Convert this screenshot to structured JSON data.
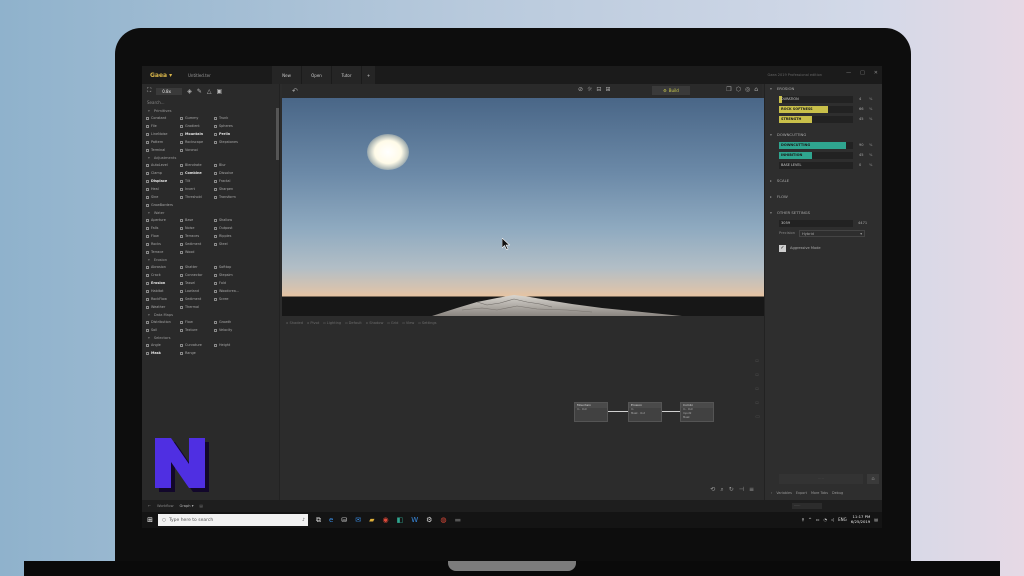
{
  "app": {
    "name": "Gaea",
    "document_name": "Untitled.ter",
    "window_status": "Gaea 2019 Professional edition",
    "tabs": [
      {
        "label": "New"
      },
      {
        "label": "Open"
      },
      {
        "label": "Tutor"
      },
      {
        "label": "+"
      }
    ]
  },
  "left_panel": {
    "scale_value": "0.8x",
    "search_placeholder": "Search...",
    "categories": [
      {
        "label": "Primitives",
        "items": [
          {
            "label": "Constant",
            "bold": false
          },
          {
            "label": "Gummy",
            "bold": false
          },
          {
            "label": "Trunk",
            "bold": false
          },
          {
            "label": "File",
            "bold": false
          },
          {
            "label": "Gradient",
            "bold": false
          },
          {
            "label": "Spheres",
            "bold": false
          },
          {
            "label": "LineNoise",
            "bold": false
          },
          {
            "label": "Mountain",
            "bold": true
          },
          {
            "label": "Perlin",
            "bold": true
          },
          {
            "label": "Pattern",
            "bold": false
          },
          {
            "label": "Rockscape",
            "bold": false
          },
          {
            "label": "Stepstones",
            "bold": false
          },
          {
            "label": "Terminal",
            "bold": false
          },
          {
            "label": "Voronoi",
            "bold": false
          }
        ]
      },
      {
        "label": "Adjustments",
        "items": [
          {
            "label": "AutoLevel",
            "bold": false
          },
          {
            "label": "Blendrate",
            "bold": false
          },
          {
            "label": "Blur",
            "bold": false
          },
          {
            "label": "Clamp",
            "bold": false
          },
          {
            "label": "Combine",
            "bold": true
          },
          {
            "label": "Dissolve",
            "bold": false
          },
          {
            "label": "Displace",
            "bold": true
          },
          {
            "label": "Tilt",
            "bold": false
          },
          {
            "label": "Fractal",
            "bold": false
          },
          {
            "label": "Heal",
            "bold": false
          },
          {
            "label": "Invert",
            "bold": false
          },
          {
            "label": "Sharpen",
            "bold": false
          },
          {
            "label": "Sine",
            "bold": false
          },
          {
            "label": "Threshold",
            "bold": false
          },
          {
            "label": "Transform",
            "bold": false
          },
          {
            "label": "GrowBorders",
            "bold": false
          }
        ]
      },
      {
        "label": "Water",
        "items": [
          {
            "label": "Aperture",
            "bold": false
          },
          {
            "label": "Base",
            "bold": false
          },
          {
            "label": "Shallow",
            "bold": false
          },
          {
            "label": "Falls",
            "bold": false
          },
          {
            "label": "Noise",
            "bold": false
          },
          {
            "label": "Outpost",
            "bold": false
          },
          {
            "label": "Flow",
            "bold": false
          },
          {
            "label": "Terraces",
            "bold": false
          },
          {
            "label": "Ripples",
            "bold": false
          },
          {
            "label": "Rocks",
            "bold": false
          },
          {
            "label": "Sediment",
            "bold": false
          },
          {
            "label": "Steel",
            "bold": false
          },
          {
            "label": "Terrace",
            "bold": false
          },
          {
            "label": "Wood",
            "bold": false
          }
        ]
      },
      {
        "label": "Erosion",
        "items": [
          {
            "label": "Abrasion",
            "bold": false
          },
          {
            "label": "Shatter",
            "bold": false
          },
          {
            "label": "Softtap",
            "bold": false
          },
          {
            "label": "Crack",
            "bold": false
          },
          {
            "label": "Connector",
            "bold": false
          },
          {
            "label": "Stepsim",
            "bold": false
          },
          {
            "label": "Erosion",
            "bold": true
          },
          {
            "label": "Tassel",
            "bold": false
          },
          {
            "label": "Fold",
            "bold": false
          },
          {
            "label": "Habitat",
            "bold": false
          },
          {
            "label": "Lowland",
            "bold": false
          },
          {
            "label": "Woodcrea...",
            "bold": false
          },
          {
            "label": "RockFlow",
            "bold": false
          },
          {
            "label": "Sediment",
            "bold": false
          },
          {
            "label": "Scree",
            "bold": false
          },
          {
            "label": "Weather",
            "bold": false
          },
          {
            "label": "Thermal",
            "bold": false
          }
        ]
      },
      {
        "label": "Data Maps",
        "items": [
          {
            "label": "Distribution",
            "bold": false
          },
          {
            "label": "Flow",
            "bold": false
          },
          {
            "label": "Growth",
            "bold": false
          },
          {
            "label": "Soil",
            "bold": false
          },
          {
            "label": "Texture",
            "bold": false
          },
          {
            "label": "Velocity",
            "bold": false
          }
        ]
      },
      {
        "label": "Selectors",
        "items": [
          {
            "label": "Angle",
            "bold": false
          },
          {
            "label": "Curvature",
            "bold": false
          },
          {
            "label": "Height",
            "bold": false
          },
          {
            "label": "Mask",
            "bold": true
          },
          {
            "label": "Range",
            "bold": false
          }
        ]
      }
    ]
  },
  "viewport": {
    "build_label": "Build",
    "bottom_tools": [
      "Shaded",
      "Pivot",
      "Lighting",
      "Default",
      "Shadow",
      "Grid",
      "View",
      "Settings"
    ]
  },
  "graph": {
    "nodes": [
      {
        "title": "Mountain",
        "ports": [
          "Out",
          "In"
        ]
      },
      {
        "title": "Erosion",
        "ports": [
          "In",
          "Mask",
          "Out"
        ]
      },
      {
        "title": "Combi",
        "ports": [
          "In",
          "Input2",
          "Mask",
          "Out"
        ]
      }
    ]
  },
  "right_panel": {
    "erosion_section": {
      "title": "EROSION",
      "sliders": [
        {
          "label": "DURATION",
          "value": "4",
          "fill_pct": 0.04,
          "color": "#c9c04a"
        },
        {
          "label": "ROCK SOFTNESS",
          "value": "66",
          "fill_pct": 0.66,
          "color": "#c9c04a"
        },
        {
          "label": "STRENGTH",
          "value": "45",
          "fill_pct": 0.45,
          "color": "#c9c04a"
        }
      ]
    },
    "downcutting_section": {
      "title": "DOWNCUTTING",
      "sliders": [
        {
          "label": "DOWNCUTTING",
          "value": "90",
          "fill_pct": 0.9,
          "color": "#2fa58f"
        },
        {
          "label": "INHIBITION",
          "value": "45",
          "fill_pct": 0.45,
          "color": "#2fa58f"
        },
        {
          "label": "BASE LEVEL",
          "value": "0",
          "fill_pct": 0.0,
          "color": "#2fa58f"
        }
      ]
    },
    "collapsed_sections": [
      "SCALE",
      "FLOW"
    ],
    "other_section": {
      "title": "OTHER SETTINGS",
      "seed_value": "3059",
      "seed_secondary": "4471",
      "precision_label": "Precision",
      "precision_value": "Hybrid",
      "checkbox_label": "Aggressive Mode",
      "checkbox_checked": true
    },
    "bottom_tabs": [
      "Variables",
      "Export",
      "More Tabs",
      "Debug"
    ]
  },
  "status_bar": {
    "workflow_label": "Workflow",
    "graph_label": "Graph"
  },
  "taskbar": {
    "search_placeholder": "Type here to search",
    "time": "11:17 PM",
    "date": "6/25/2019",
    "lang": "ENG"
  },
  "colors": {
    "accent_gold": "#d8b54a",
    "slider_yellow": "#c9c04a",
    "slider_teal": "#2fa58f",
    "logo_purple": "#4f2fe2"
  }
}
